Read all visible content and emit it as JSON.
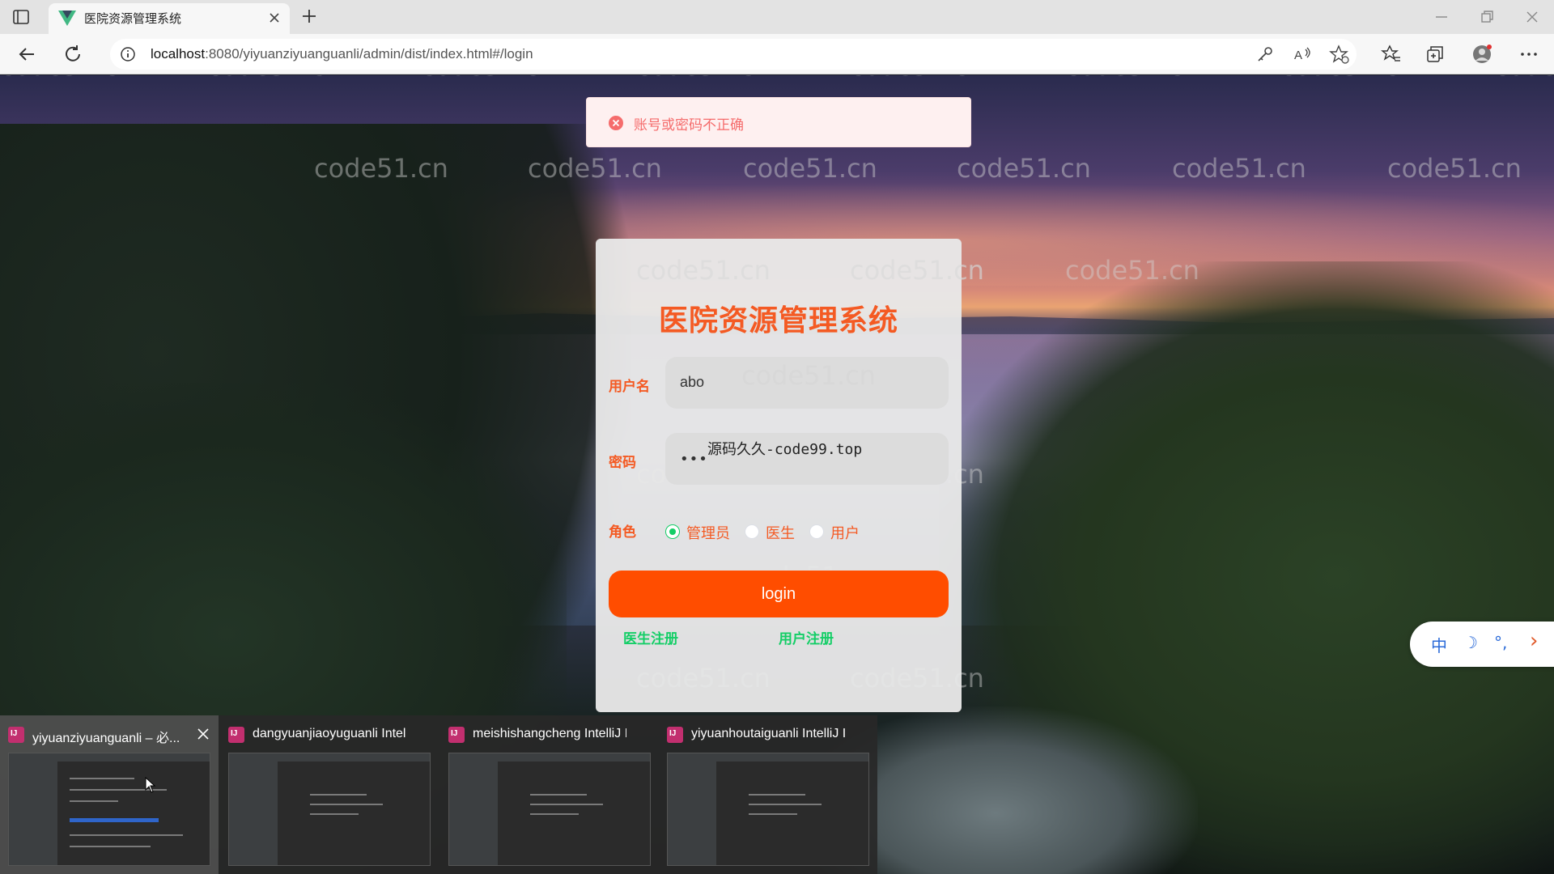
{
  "browser": {
    "tab_title": "医院资源管理系统",
    "url_host": "localhost",
    "url_rest": ":8080/yiyuanziyuanguanli/admin/dist/index.html#/login"
  },
  "toast": {
    "message": "账号或密码不正确",
    "icon": "error-circle-icon"
  },
  "login": {
    "title": "医院资源管理系统",
    "username_label": "用户名",
    "username_value": "abo",
    "password_label": "密码",
    "password_value": "•••",
    "password_overlay": "源码久久-code99.top",
    "role_label": "角色",
    "roles": [
      {
        "label": "管理员",
        "checked": true
      },
      {
        "label": "医生",
        "checked": false
      },
      {
        "label": "用户",
        "checked": false
      }
    ],
    "login_button": "login",
    "doctor_register": "医生注册",
    "user_register": "用户注册"
  },
  "ime": {
    "items": [
      "中",
      "☽",
      "°,",
      "›"
    ]
  },
  "watermark_text": "code51.cn",
  "taskbar_previews": [
    {
      "title": "yiyuanziyuanguanli – 必...",
      "active": true
    },
    {
      "title": "dangyuanjiaoyuguanli IntelliJ...",
      "active": false
    },
    {
      "title": "meishishangcheng IntelliJ ID...",
      "active": false
    },
    {
      "title": "yiyuanhoutaiguanli IntelliJ ID...",
      "active": false
    }
  ],
  "colors": {
    "accent": "#f45a23",
    "button": "#ff4d00",
    "radio_checked": "#13ce66",
    "toast_text": "#f56c6c"
  }
}
